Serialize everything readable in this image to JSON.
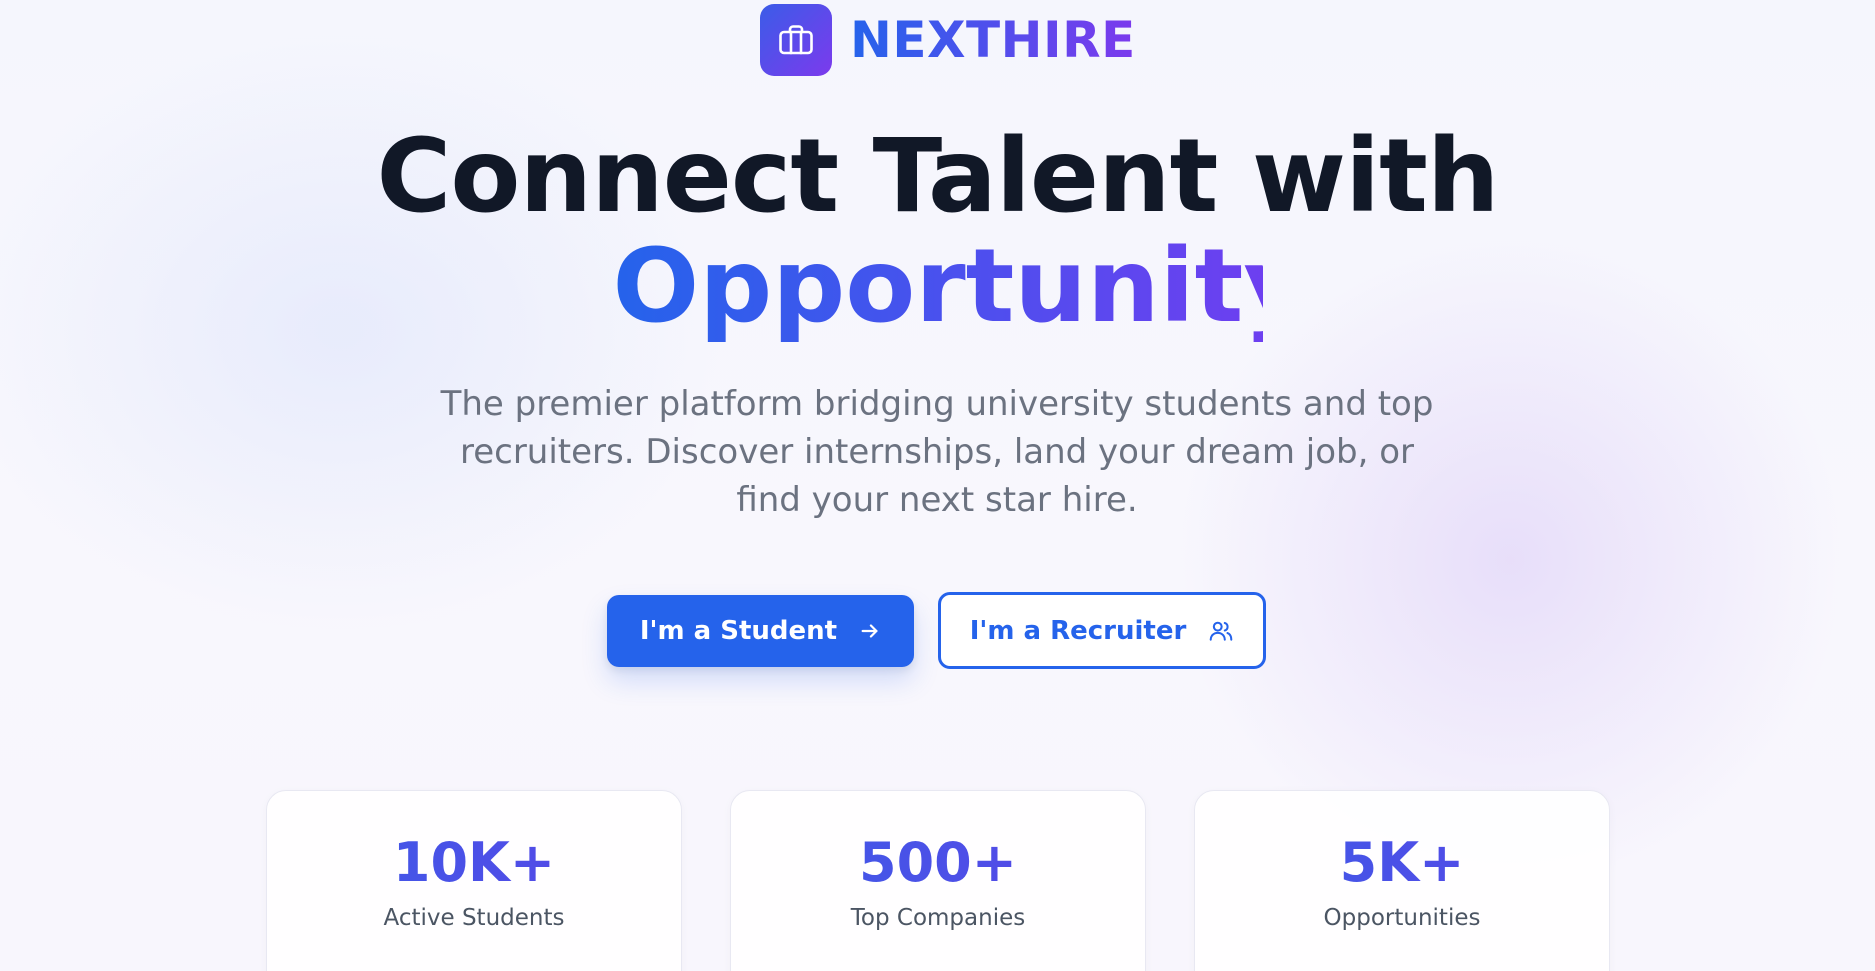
{
  "brand": {
    "name": "NEXTHIRE",
    "logo_icon": "briefcase-icon"
  },
  "hero": {
    "title_line1": "Connect Talent with",
    "title_line2": "Opportunity",
    "subtitle": "The premier platform bridging university students and top recruiters. Discover internships, land your dream job, or find your next star hire."
  },
  "actions": {
    "student_label": "I'm a Student",
    "student_icon": "arrow-right-icon",
    "recruiter_label": "I'm a Recruiter",
    "recruiter_icon": "users-icon"
  },
  "stats": [
    {
      "value": "10K+",
      "label": "Active Students"
    },
    {
      "value": "500+",
      "label": "Top Companies"
    },
    {
      "value": "5K+",
      "label": "Opportunities"
    }
  ],
  "colors": {
    "primary": "#2563eb",
    "accent": "#7c3aed",
    "heading": "#111827",
    "muted": "#6b7280",
    "stat_value": "#4f46e5"
  }
}
